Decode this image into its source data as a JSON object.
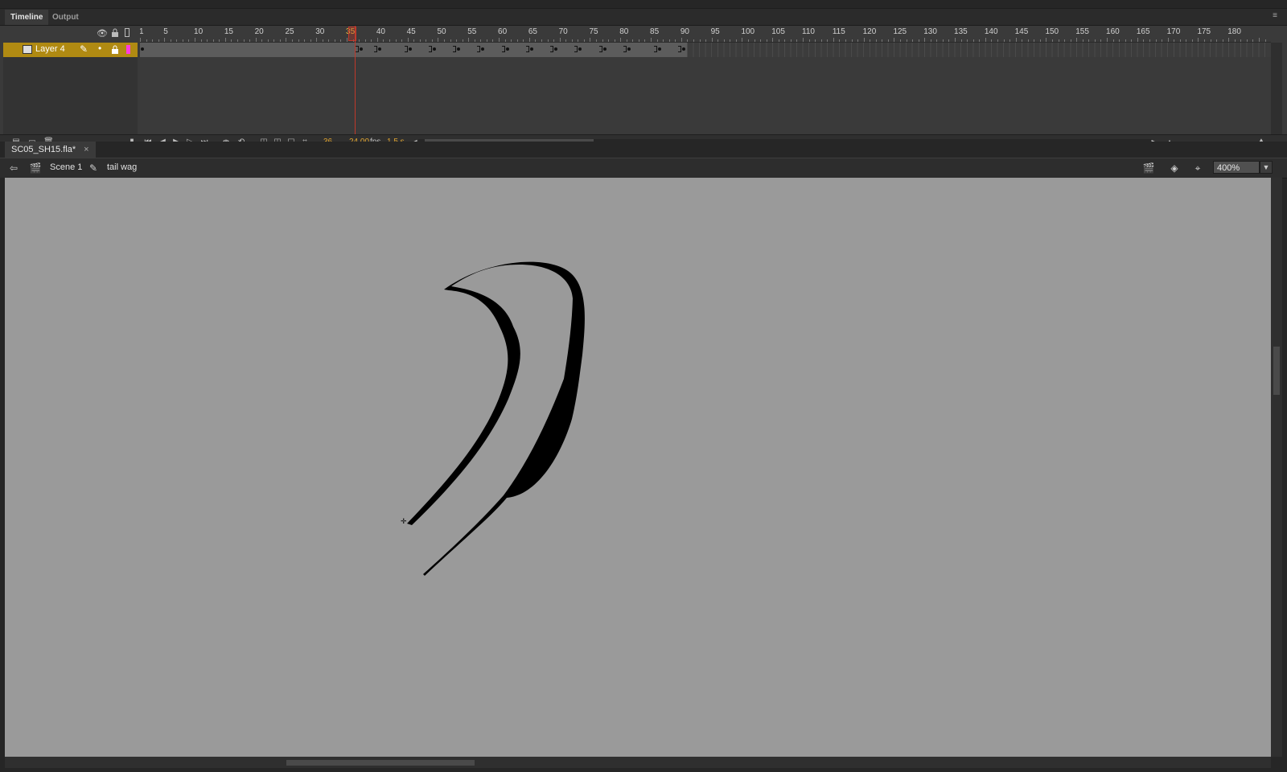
{
  "panel": {
    "tabs": [
      {
        "label": "Timeline",
        "active": true
      },
      {
        "label": "Output",
        "active": false
      }
    ]
  },
  "timeline": {
    "ruler_labels": [
      "1",
      "5",
      "10",
      "15",
      "20",
      "25",
      "30",
      "35",
      "40",
      "45",
      "50",
      "55",
      "60",
      "65",
      "70",
      "75",
      "80",
      "85",
      "90",
      "95",
      "100",
      "105",
      "110",
      "115",
      "120",
      "125",
      "130",
      "135",
      "140",
      "145",
      "150",
      "155",
      "160",
      "165",
      "170",
      "175",
      "180"
    ],
    "current_frame_marker": "35",
    "layer": {
      "name": "Layer 4",
      "outline_color": "#ff3ce0"
    },
    "keyframe_frames": [
      1,
      37,
      40,
      45,
      49,
      53,
      57,
      61,
      65,
      69,
      73,
      77,
      81,
      86,
      90
    ],
    "bottom": {
      "current_frame": "36",
      "fps": "24.00",
      "fps_unit": "fps",
      "elapsed": "1.5 s"
    }
  },
  "document": {
    "tab_label": "SC05_SH15.fla*",
    "close": "×"
  },
  "editbar": {
    "scene": "Scene 1",
    "symbol": "tail wag",
    "zoom": "400%"
  },
  "colors": {
    "playhead": "#c0392b",
    "layer_highlight": "#b08a12",
    "stage": "#9a9a9a",
    "accent_text": "#e0a430"
  }
}
